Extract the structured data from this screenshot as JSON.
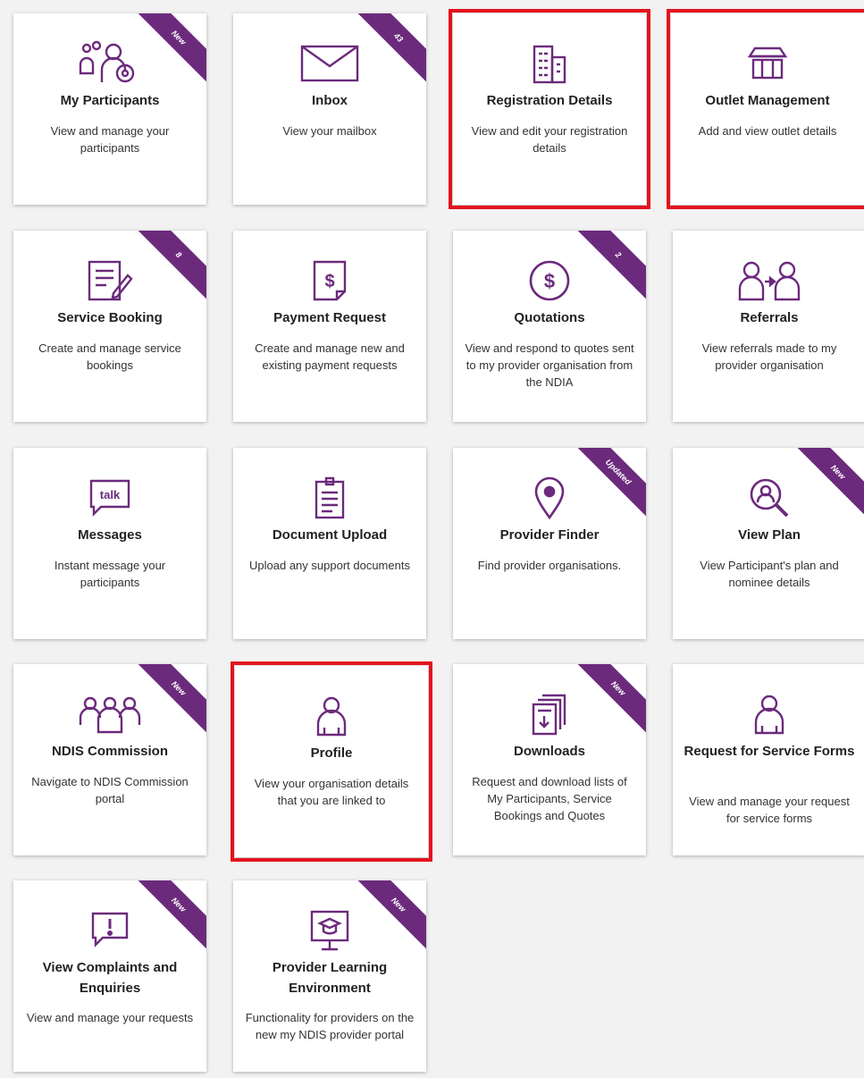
{
  "theme": {
    "accent": "#6c2a7d",
    "highlight": "#e3131e",
    "card": "#ffffff",
    "background": "#f3f2f2"
  },
  "tiles": [
    {
      "title": "My Participants",
      "desc": "View and manage your participants",
      "ribbon": "New",
      "icon": "participants-search-icon",
      "highlighted": false
    },
    {
      "title": "Inbox",
      "desc": "View your mailbox",
      "ribbon": "43",
      "icon": "envelope-icon",
      "highlighted": false
    },
    {
      "title": "Registration Details",
      "desc": "View and edit your registration details",
      "ribbon": "",
      "icon": "building-icon",
      "highlighted": true
    },
    {
      "title": "Outlet Management",
      "desc": "Add and view outlet details",
      "ribbon": "",
      "icon": "storefront-icon",
      "highlighted": true
    },
    {
      "title": "Service Booking",
      "desc": "Create and manage service bookings",
      "ribbon": "8",
      "icon": "document-edit-icon",
      "highlighted": false
    },
    {
      "title": "Payment Request",
      "desc": "Create and manage new and existing payment requests",
      "ribbon": "",
      "icon": "dollar-document-icon",
      "highlighted": false
    },
    {
      "title": "Quotations",
      "desc": "View and respond to quotes sent to my provider organisation from the NDIA",
      "ribbon": "2",
      "icon": "dollar-circle-icon",
      "highlighted": false
    },
    {
      "title": "Referrals",
      "desc": "View referrals made to my provider organisation",
      "ribbon": "",
      "icon": "referral-people-icon",
      "highlighted": false
    },
    {
      "title": "Messages",
      "desc": "Instant message your participants",
      "ribbon": "",
      "icon": "talk-bubble-icon",
      "highlighted": false
    },
    {
      "title": "Document Upload",
      "desc": "Upload any support documents",
      "ribbon": "",
      "icon": "clipboard-icon",
      "highlighted": false
    },
    {
      "title": "Provider Finder",
      "desc": "Find provider organisations.",
      "ribbon": "Updated",
      "icon": "map-pin-icon",
      "highlighted": false
    },
    {
      "title": "View Plan",
      "desc": "View Participant's plan and nominee details",
      "ribbon": "New",
      "icon": "person-magnifier-icon",
      "highlighted": false
    },
    {
      "title": "NDIS Commission",
      "desc": "Navigate to NDIS Commission portal",
      "ribbon": "New",
      "icon": "group-icon",
      "highlighted": false
    },
    {
      "title": "Profile",
      "desc": "View your organisation details that you are linked to",
      "ribbon": "",
      "icon": "person-icon",
      "highlighted": true
    },
    {
      "title": "Downloads",
      "desc": "Request and download lists of My Participants, Service Bookings and Quotes",
      "ribbon": "New",
      "icon": "download-documents-icon",
      "highlighted": false
    },
    {
      "title": "Request for Service Forms",
      "desc": "View and manage your request for service forms",
      "ribbon": "",
      "icon": "person-icon",
      "highlighted": false
    },
    {
      "title": "View Complaints and Enquiries",
      "desc": "View and manage your requests",
      "ribbon": "New",
      "icon": "exclamation-bubble-icon",
      "highlighted": false
    },
    {
      "title": "Provider Learning Environment",
      "desc": "Functionality for providers on the new my NDIS provider portal",
      "ribbon": "New",
      "icon": "graduation-monitor-icon",
      "highlighted": false
    }
  ]
}
